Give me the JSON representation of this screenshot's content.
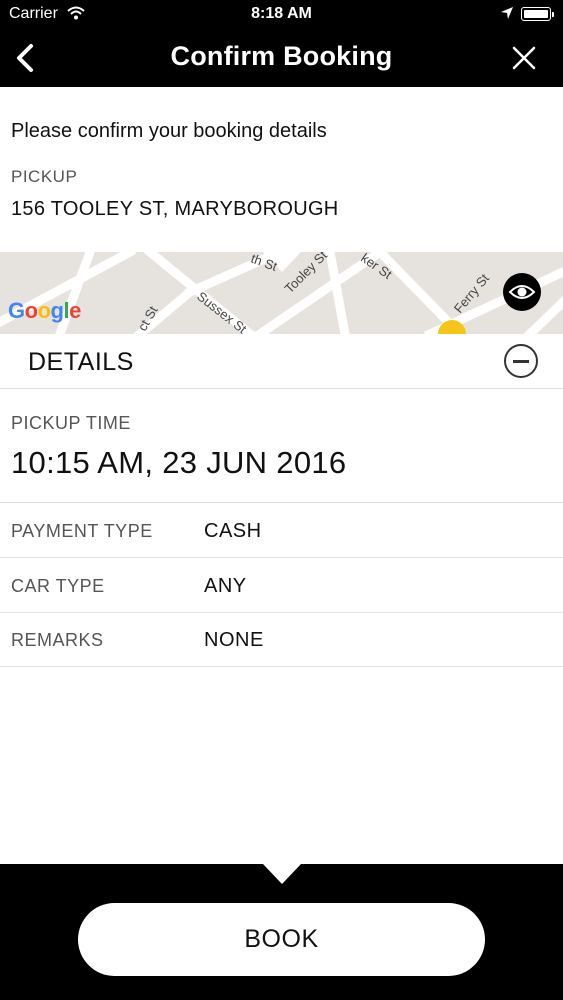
{
  "status_bar": {
    "carrier": "Carrier",
    "time": "8:18 AM",
    "icons": [
      "wifi-icon",
      "location-arrow-icon",
      "battery-icon"
    ]
  },
  "nav": {
    "title": "Confirm Booking",
    "back_icon": "chevron-left-icon",
    "close_icon": "close-icon"
  },
  "intro": "Please confirm your booking details",
  "pickup": {
    "label": "PICKUP",
    "address": "156 TOOLEY ST, MARYBOROUGH"
  },
  "map": {
    "attribution": "Google",
    "street_labels": [
      "th St",
      "Tooley St",
      "ker St",
      "Ferry St",
      "Sussex St",
      "ct St"
    ],
    "view_icon": "eye-icon"
  },
  "details": {
    "header": "DETAILS",
    "toggle_icon": "minus-circle-icon",
    "pickup_time_label": "PICKUP TIME",
    "pickup_time_value": "10:15 AM, 23 JUN 2016",
    "rows": [
      {
        "label": "PAYMENT TYPE",
        "value": "CASH"
      },
      {
        "label": "CAR TYPE",
        "value": "ANY"
      },
      {
        "label": "REMARKS",
        "value": "NONE"
      }
    ]
  },
  "book_button": "BOOK",
  "colors": {
    "bar_background": "#000000",
    "map_background": "#e6e3de",
    "map_marker": "#f5c518"
  }
}
